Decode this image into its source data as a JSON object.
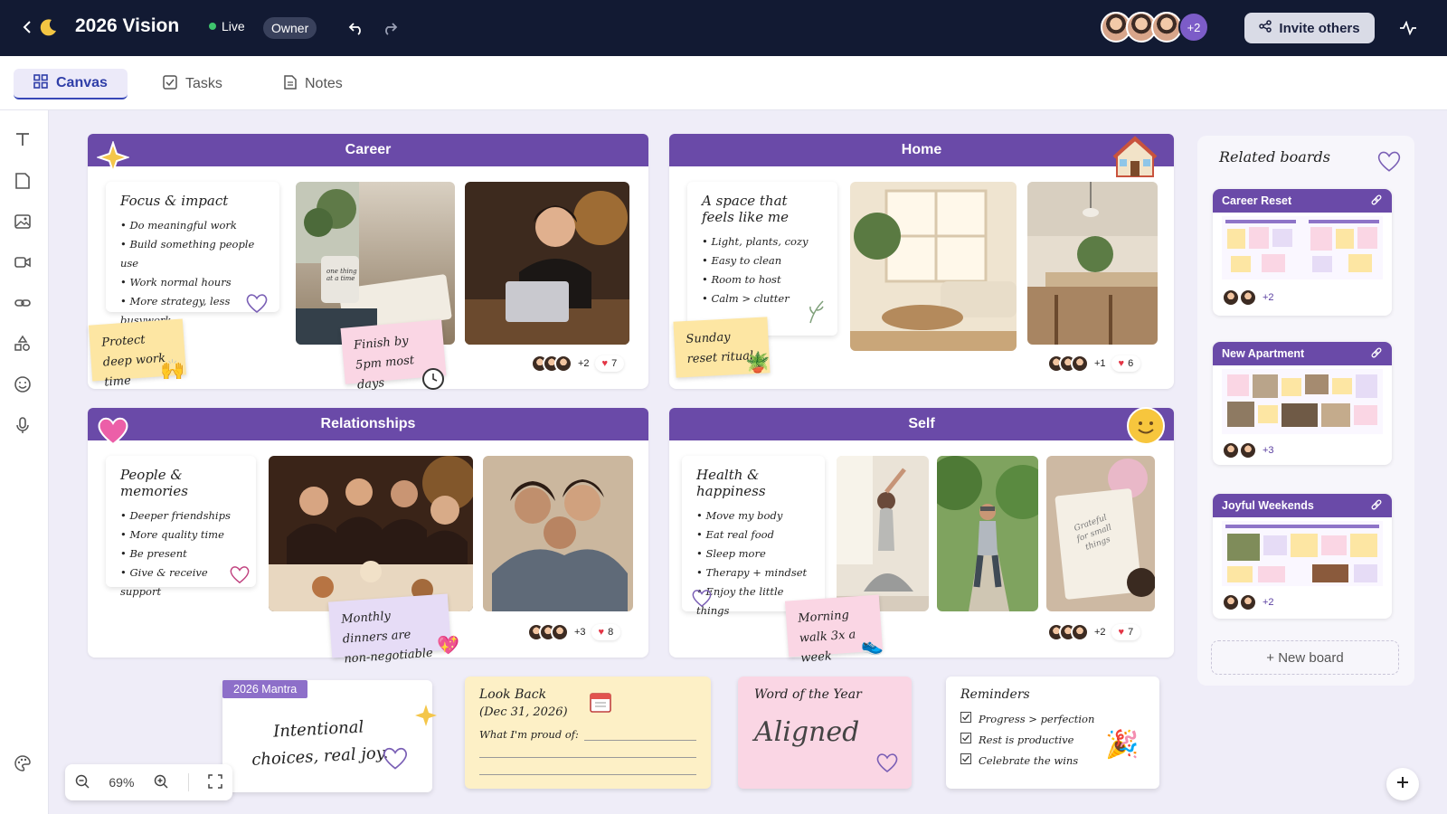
{
  "header": {
    "title": "2026 Vision",
    "live": "Live",
    "role": "Owner",
    "extra_collaborators": "+2",
    "invite_label": "Invite others"
  },
  "tabs": [
    {
      "label": "Canvas"
    },
    {
      "label": "Tasks"
    },
    {
      "label": "Notes"
    }
  ],
  "sections": {
    "career": {
      "title": "Career",
      "note_title": "Focus & impact",
      "bullets": [
        "Do meaningful work",
        "Build something people use",
        "Work normal hours",
        "More strategy, less busywork"
      ],
      "sticky1": "Protect deep work time",
      "sticky2": "Finish by 5pm most days",
      "mug_text": "one thing at a time",
      "extra": "+2",
      "likes": "7"
    },
    "home": {
      "title": "Home",
      "note_title": "A space that feels like me",
      "bullets": [
        "Light, plants, cozy",
        "Easy to clean",
        "Room to host",
        "Calm > clutter"
      ],
      "sticky1": "Sunday reset ritual",
      "extra": "+1",
      "likes": "6"
    },
    "relationships": {
      "title": "Relationships",
      "note_title": "People & memories",
      "bullets": [
        "Deeper friendships",
        "More quality time",
        "Be present",
        "Give & receive support"
      ],
      "sticky1": "Monthly dinners are non-negotiable",
      "extra": "+3",
      "likes": "8"
    },
    "self": {
      "title": "Self",
      "note_title": "Health & happiness",
      "bullets": [
        "Move my body",
        "Eat real food",
        "Sleep more",
        "Therapy + mindset",
        "Enjoy the little things"
      ],
      "sticky1": "Morning walk 3x a week",
      "journal_text": "Grateful for small things",
      "extra": "+2",
      "likes": "7"
    }
  },
  "bottom": {
    "mantra": {
      "tag": "2026 Mantra",
      "text": "Intentional choices, real joy."
    },
    "lookback": {
      "title": "Look Back",
      "date": "(Dec 31, 2026)",
      "prompt": "What I'm proud of:"
    },
    "word": {
      "title": "Word of the Year",
      "word": "Aligned"
    },
    "reminders": {
      "title": "Reminders",
      "items": [
        "Progress > perfection",
        "Rest is productive",
        "Celebrate the wins"
      ]
    }
  },
  "related": {
    "title": "Related boards",
    "boards": [
      {
        "name": "Career Reset",
        "extra": "+2"
      },
      {
        "name": "New Apartment",
        "extra": "+3"
      },
      {
        "name": "Joyful Weekends",
        "extra": "+2"
      }
    ],
    "new_board": "+ New board"
  },
  "zoom": {
    "level": "69%"
  }
}
